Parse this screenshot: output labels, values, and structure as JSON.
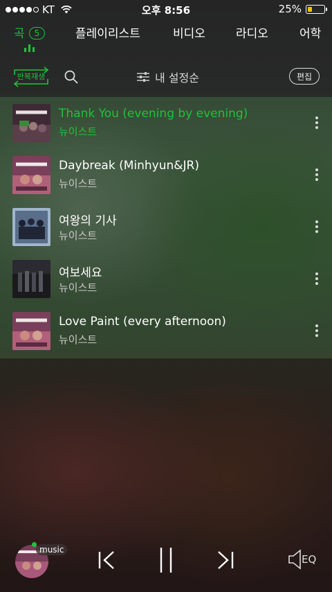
{
  "status_bar": {
    "carrier": "KT",
    "time": "오후 8:56",
    "battery": "25%",
    "battery_level": 0.25
  },
  "tabs": [
    {
      "label": "곡",
      "count": "5",
      "active": true
    },
    {
      "label": "플레이리스트",
      "active": false
    },
    {
      "label": "비디오",
      "active": false
    },
    {
      "label": "라디오",
      "active": false
    },
    {
      "label": "어학",
      "active": false
    }
  ],
  "toolbar": {
    "repeat_label": "반복재생",
    "sort_label": "내 설정순",
    "edit_label": "편집"
  },
  "songs": [
    {
      "title": "Thank You (evening by evening)",
      "artist": "뉴이스트",
      "playing": true,
      "art": "nuest-purple"
    },
    {
      "title": "Daybreak (Minhyun&JR)",
      "artist": "뉴이스트",
      "playing": false,
      "art": "nuest-pink"
    },
    {
      "title": "여왕의 기사",
      "artist": "뉴이스트",
      "playing": false,
      "art": "group-blue"
    },
    {
      "title": "여보세요",
      "artist": "뉴이스트",
      "playing": false,
      "art": "group-dark"
    },
    {
      "title": "Love Paint (every afternoon)",
      "artist": "뉴이스트",
      "playing": false,
      "art": "nuest-pink"
    }
  ],
  "player": {
    "tag": "music",
    "eq_label": "EQ"
  },
  "colors": {
    "accent": "#1ec33a",
    "battery": "#f5c400"
  }
}
